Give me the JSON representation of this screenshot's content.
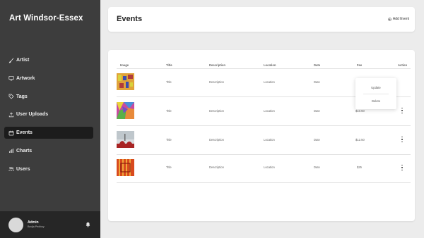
{
  "sidebar": {
    "brand": "Art Windsor-Essex",
    "items": [
      {
        "label": "Artist",
        "icon": "brush-icon",
        "active": false
      },
      {
        "label": "Artwork",
        "icon": "monitor-icon",
        "active": false
      },
      {
        "label": "Tags",
        "icon": "tag-icon",
        "active": false
      },
      {
        "label": "User Uploads",
        "icon": "upload-icon",
        "active": false
      },
      {
        "label": "Events",
        "icon": "calendar-icon",
        "active": true
      },
      {
        "label": "Charts",
        "icon": "bar-chart-icon",
        "active": false
      },
      {
        "label": "Users",
        "icon": "users-icon",
        "active": false
      }
    ],
    "user": {
      "name": "Admin",
      "email": "Bedja Pedboy"
    }
  },
  "header": {
    "title": "Events",
    "add_label": "Add Event"
  },
  "table": {
    "columns": [
      "Image",
      "Title",
      "Description",
      "Location",
      "Date",
      "Fee",
      "Action"
    ],
    "rows": [
      {
        "title": "Title",
        "description": "Description",
        "location": "Location",
        "date": "Date",
        "fee": ""
      },
      {
        "title": "Title",
        "description": "Description",
        "location": "Location",
        "date": "Date",
        "fee": "$10.50"
      },
      {
        "title": "Title",
        "description": "Description",
        "location": "Location",
        "date": "Date",
        "fee": "$12.50"
      },
      {
        "title": "Title",
        "description": "Description",
        "location": "Location",
        "date": "Date",
        "fee": "$25"
      }
    ]
  },
  "action_menu": {
    "update_label": "Update",
    "delete_label": "Delete"
  },
  "colors": {
    "sidebar_bg": "#3d3d3d",
    "active_bg": "#1c1c1c",
    "page_bg": "#ececec"
  }
}
